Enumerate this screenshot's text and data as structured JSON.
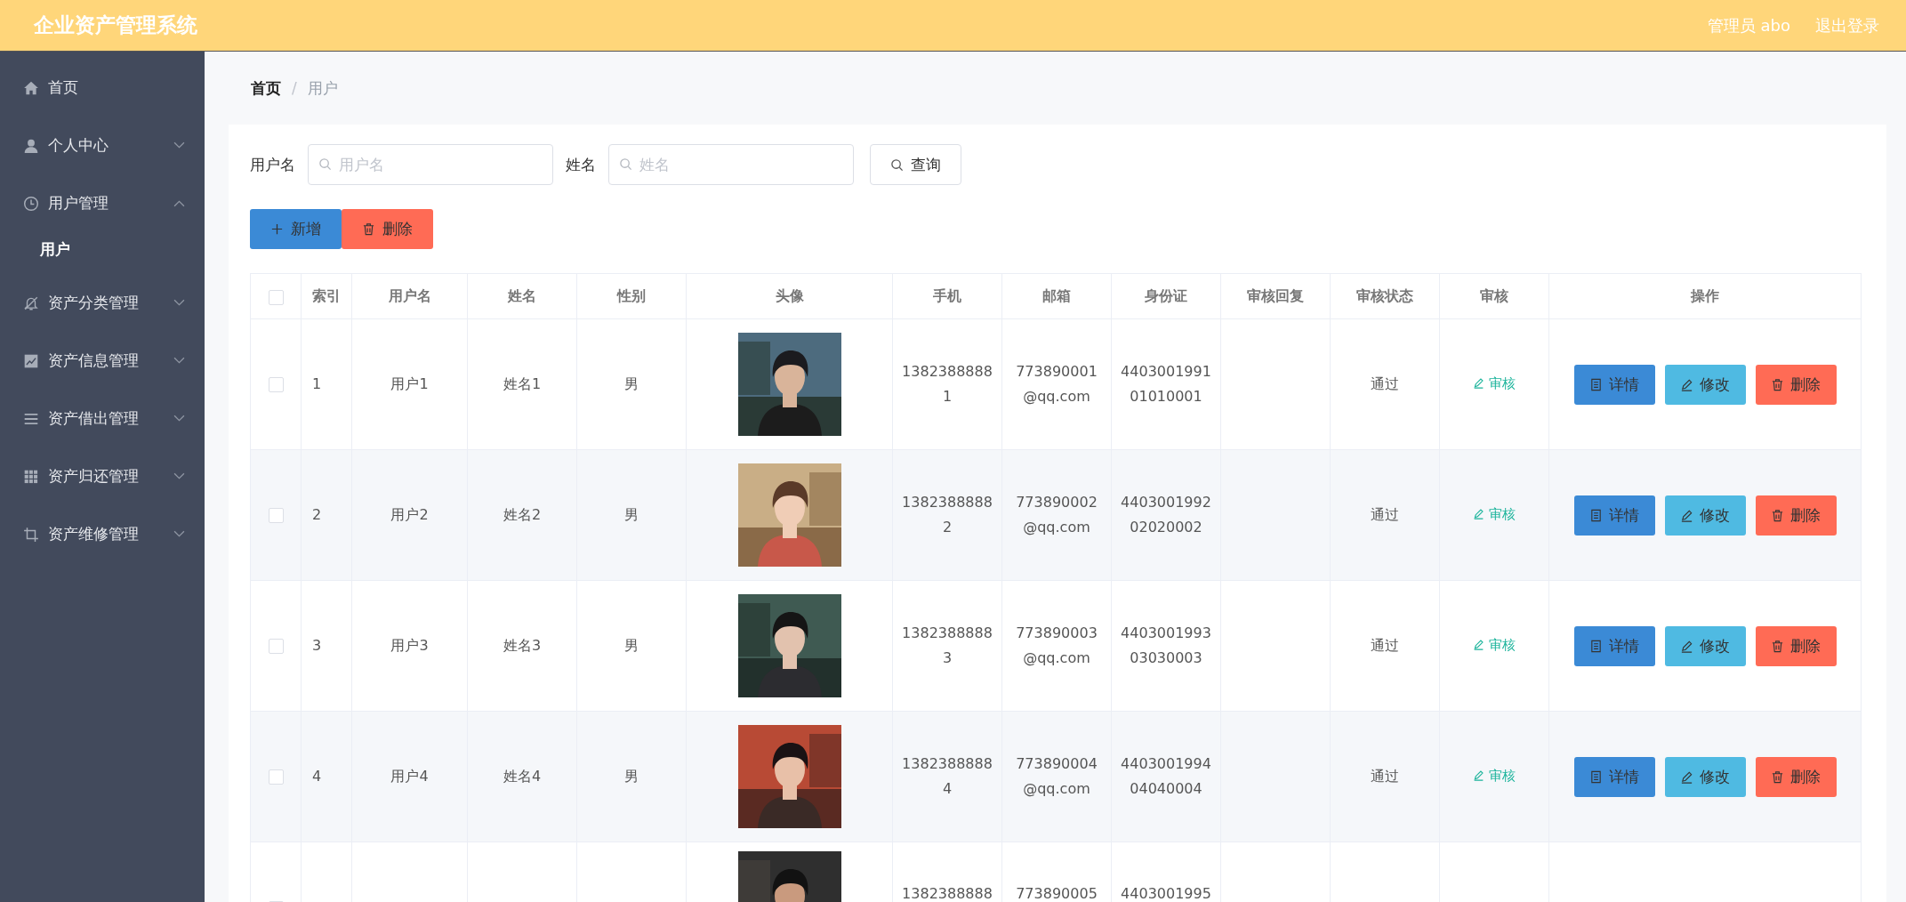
{
  "header": {
    "title": "企业资产管理系统",
    "user": "管理员 abo",
    "logout": "退出登录"
  },
  "sidebar": {
    "items": [
      {
        "label": "首页"
      },
      {
        "label": "个人中心",
        "expanded": false
      },
      {
        "label": "用户管理",
        "expanded": true,
        "children": [
          {
            "label": "用户",
            "selected": true
          }
        ]
      },
      {
        "label": "资产分类管理",
        "expanded": false
      },
      {
        "label": "资产信息管理",
        "expanded": false
      },
      {
        "label": "资产借出管理",
        "expanded": false
      },
      {
        "label": "资产归还管理",
        "expanded": false
      },
      {
        "label": "资产维修管理",
        "expanded": false
      }
    ]
  },
  "breadcrumb": [
    "首页",
    "用户"
  ],
  "breadcrumb_separator": "/",
  "search": {
    "fields": [
      {
        "label": "用户名",
        "placeholder": "用户名"
      },
      {
        "label": "姓名",
        "placeholder": "姓名"
      }
    ],
    "button": "查询"
  },
  "actions": {
    "add": "新增",
    "delete": "删除"
  },
  "table": {
    "select_all": {
      "checked": false
    },
    "columns": [
      "索引",
      "用户名",
      "姓名",
      "性别",
      "头像",
      "手机",
      "邮箱",
      "身份证",
      "审核回复",
      "审核状态",
      "审核",
      "操作"
    ],
    "rows": [
      {
        "checked": false,
        "index": "1",
        "username": "用户1",
        "name": "姓名1",
        "gender": "男",
        "phone": "13823888881",
        "email": "773890001@qq.com",
        "id_card": "440300199101010001",
        "status": "通过",
        "review": "审核",
        "buttons": [
          "详情",
          "修改",
          "删除"
        ]
      },
      {
        "checked": false,
        "index": "2",
        "username": "用户2",
        "name": "姓名2",
        "gender": "男",
        "phone": "13823888882",
        "email": "773890002@qq.com",
        "id_card": "440300199202020002",
        "status": "通过",
        "review": "审核",
        "buttons": [
          "详情",
          "修改",
          "删除"
        ]
      },
      {
        "checked": false,
        "index": "3",
        "username": "用户3",
        "name": "姓名3",
        "gender": "男",
        "phone": "13823888883",
        "email": "773890003@qq.com",
        "id_card": "440300199303030003",
        "status": "通过",
        "review": "审核",
        "buttons": [
          "详情",
          "修改",
          "删除"
        ]
      },
      {
        "checked": false,
        "index": "4",
        "username": "用户4",
        "name": "姓名4",
        "gender": "男",
        "phone": "13823888884",
        "email": "773890004@qq.com",
        "id_card": "440300199404040004",
        "status": "通过",
        "review": "审核",
        "buttons": [
          "详情",
          "修改",
          "删除"
        ]
      },
      {
        "checked": false,
        "phone": "1382388888",
        "email": "773890005",
        "id_card": "4403001995"
      }
    ]
  }
}
